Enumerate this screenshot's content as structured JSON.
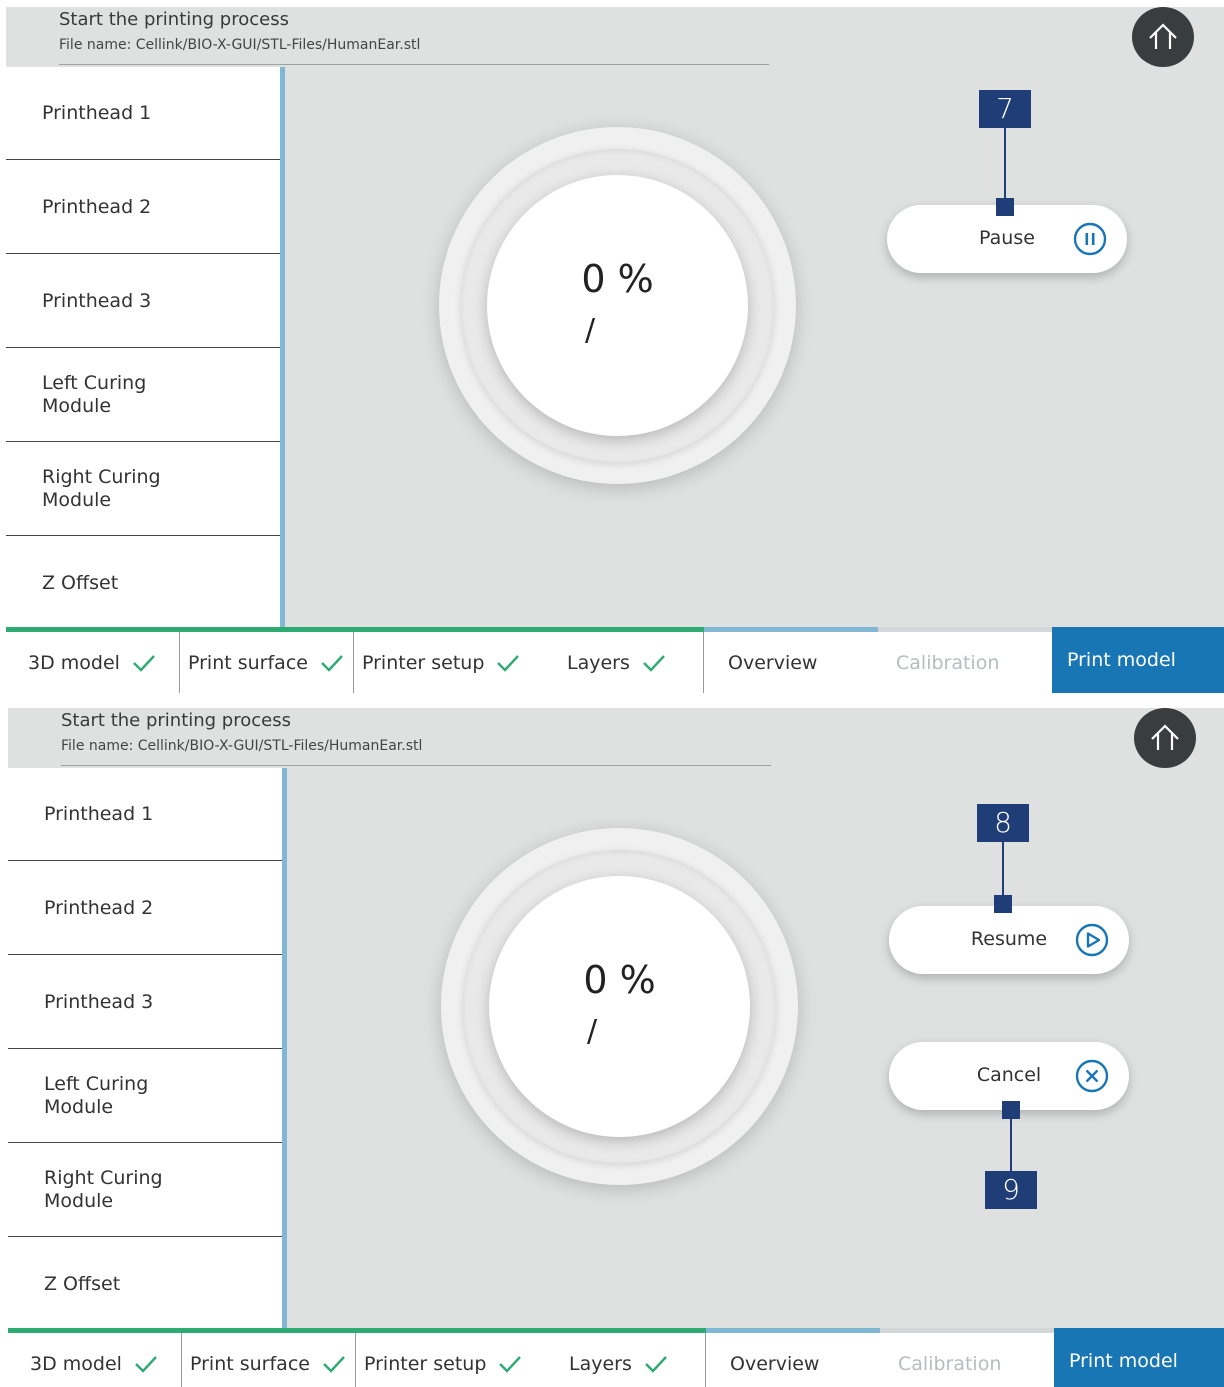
{
  "screens": [
    {
      "header": {
        "title": "Start the printing process",
        "file_name": "File name: Cellink/BIO-X-GUI/STL-Files/HumanEar.stl"
      },
      "sidebar": {
        "items": [
          {
            "label": "Printhead 1"
          },
          {
            "label": "Printhead 2"
          },
          {
            "label": "Printhead 3"
          },
          {
            "label": "Left Curing\nModule"
          },
          {
            "label": "Right Curing\nModule"
          },
          {
            "label": "Z Offset"
          }
        ]
      },
      "progress": {
        "percent_text": "0 %",
        "sub_text": "/"
      },
      "buttons": {
        "pause_label": "Pause"
      },
      "callouts": {
        "pause": "7"
      }
    },
    {
      "header": {
        "title": "Start the printing process",
        "file_name": "File name: Cellink/BIO-X-GUI/STL-Files/HumanEar.stl"
      },
      "sidebar": {
        "items": [
          {
            "label": "Printhead 1"
          },
          {
            "label": "Printhead 2"
          },
          {
            "label": "Printhead 3"
          },
          {
            "label": "Left Curing\nModule"
          },
          {
            "label": "Right Curing\nModule"
          },
          {
            "label": "Z Offset"
          }
        ]
      },
      "progress": {
        "percent_text": "0 %",
        "sub_text": "/"
      },
      "buttons": {
        "resume_label": "Resume",
        "cancel_label": "Cancel"
      },
      "callouts": {
        "resume": "8",
        "cancel": "9"
      }
    }
  ],
  "tabs": [
    {
      "label": "3D model",
      "state": "done"
    },
    {
      "label": "Print surface",
      "state": "done"
    },
    {
      "label": "Printer setup",
      "state": "done"
    },
    {
      "label": "Layers",
      "state": "done"
    },
    {
      "label": "Overview",
      "state": "current"
    },
    {
      "label": "Calibration",
      "state": "inactive"
    },
    {
      "label": "Print model",
      "state": "active"
    }
  ],
  "colors": {
    "done_progress": "#2eaa73",
    "current_progress": "#7fb7d4",
    "active_tab": "#1976b4",
    "callout": "#1f3e78",
    "check": "#2eaa73"
  },
  "icons": {
    "home": "home-icon",
    "pause": "pause-circle-icon",
    "resume": "play-circle-icon",
    "cancel": "close-circle-icon",
    "check": "check-icon"
  }
}
